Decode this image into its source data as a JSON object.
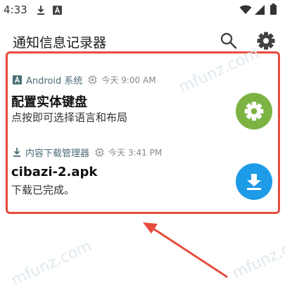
{
  "status_bar": {
    "time": "4:33",
    "icons": [
      "download-icon",
      "a-box-icon",
      "wifi-icon",
      "signal-icon",
      "battery-icon"
    ]
  },
  "app_bar": {
    "title": "通知信息记录器",
    "actions": [
      "search-icon",
      "gear-icon"
    ]
  },
  "notifications": [
    {
      "app_icon": "a-box-icon",
      "source": "Android 系统",
      "time": "今天 9:00 AM",
      "title": "配置实体键盘",
      "text": "点按即可选择语言和布局",
      "action_icon": "gear-icon",
      "action_color": "#7cb342"
    },
    {
      "app_icon": "download-icon",
      "source": "内容下载管理器",
      "time": "今天 3:41 PM",
      "title": "cibazi-2.apk",
      "text": "下载已完成。",
      "action_icon": "download-icon",
      "action_color": "#1e9be6"
    }
  ],
  "annotation": {
    "highlight_color": "#e74c3c",
    "arrow_color": "#e74c3c"
  },
  "watermark": {
    "text": "mfunz.com"
  }
}
